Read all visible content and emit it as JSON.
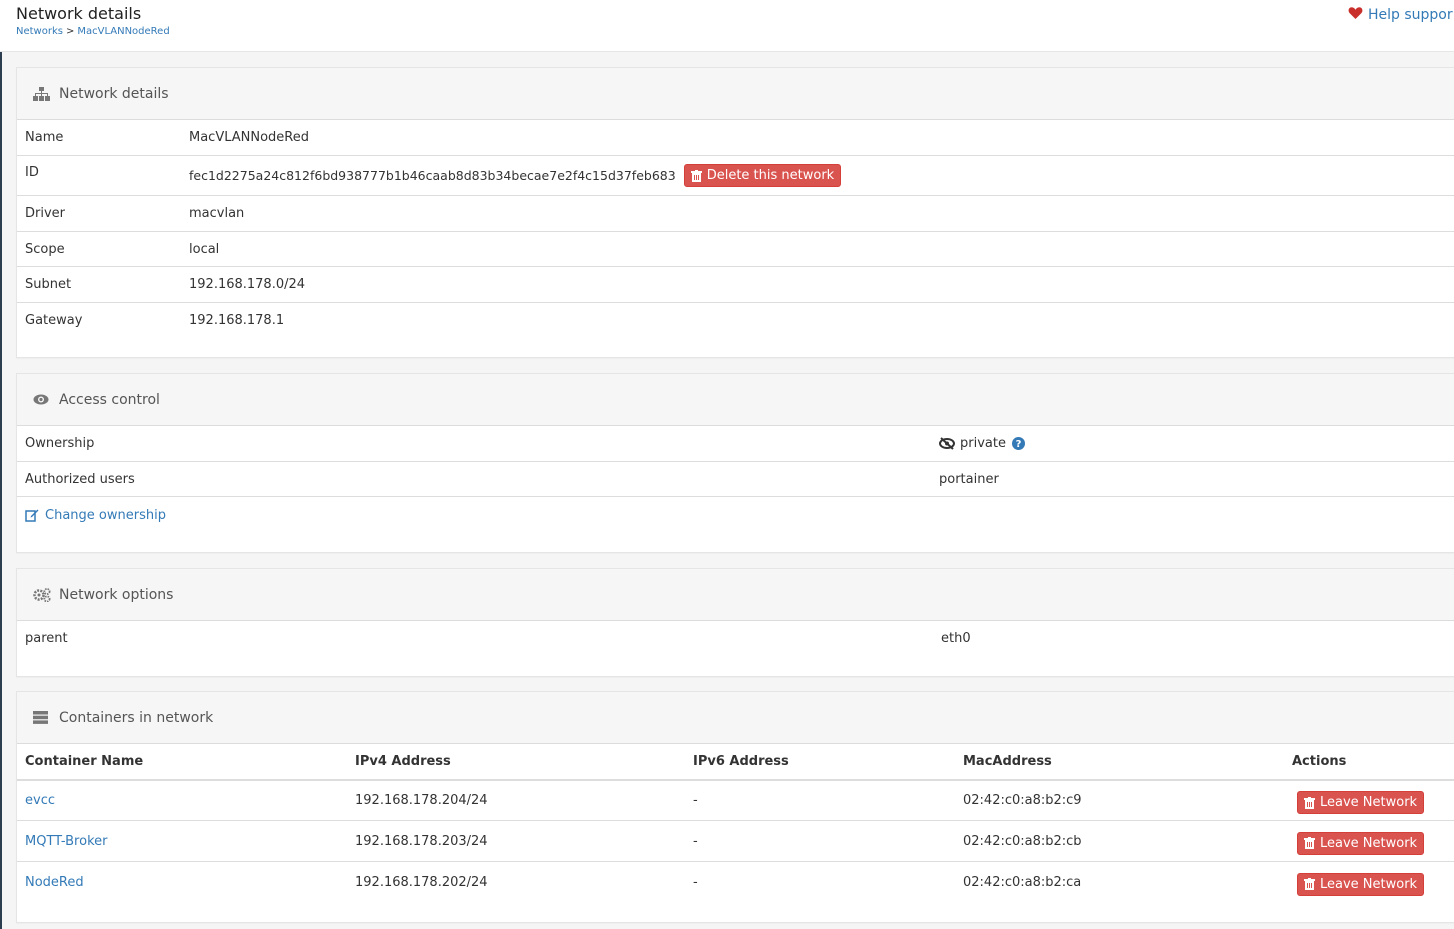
{
  "header": {
    "title": "Network details",
    "breadcrumb": {
      "networks": "Networks",
      "separator": ">",
      "current": "MacVLANNodeRed"
    },
    "help_label": "Help suppor"
  },
  "details": {
    "title": "Network details",
    "icon": "sitemap-icon",
    "rows": {
      "name": {
        "label": "Name",
        "value": "MacVLANNodeRed"
      },
      "id": {
        "label": "ID",
        "value": "fec1d2275a24c812f6bd938777b1b46caab8d83b34becae7e2f4c15d37feb683"
      },
      "driver": {
        "label": "Driver",
        "value": "macvlan"
      },
      "scope": {
        "label": "Scope",
        "value": "local"
      },
      "subnet": {
        "label": "Subnet",
        "value": "192.168.178.0/24"
      },
      "gateway": {
        "label": "Gateway",
        "value": "192.168.178.1"
      }
    },
    "delete_label": "Delete this network"
  },
  "access": {
    "title": "Access control",
    "icon": "eye-icon",
    "ownership_label": "Ownership",
    "ownership_value": "private",
    "authorized_label": "Authorized users",
    "authorized_value": "portainer",
    "change_label": "Change ownership"
  },
  "options": {
    "title": "Network options",
    "icon": "cogs-icon",
    "parent_label": "parent",
    "parent_value": "eth0"
  },
  "containers": {
    "title": "Containers in network",
    "icon": "server-icon",
    "columns": {
      "name": "Container Name",
      "ipv4": "IPv4 Address",
      "ipv6": "IPv6 Address",
      "mac": "MacAddress",
      "actions": "Actions"
    },
    "rows": [
      {
        "name": "evcc",
        "ipv4": "192.168.178.204/24",
        "ipv6": "-",
        "mac": "02:42:c0:a8:b2:c9",
        "action": "Leave Network"
      },
      {
        "name": "MQTT-Broker",
        "ipv4": "192.168.178.203/24",
        "ipv6": "-",
        "mac": "02:42:c0:a8:b2:cb",
        "action": "Leave Network"
      },
      {
        "name": "NodeRed",
        "ipv4": "192.168.178.202/24",
        "ipv6": "-",
        "mac": "02:42:c0:a8:b2:ca",
        "action": "Leave Network"
      }
    ]
  },
  "colors": {
    "danger": "#d9534f",
    "link": "#337ab7",
    "heart": "#c9302c"
  }
}
